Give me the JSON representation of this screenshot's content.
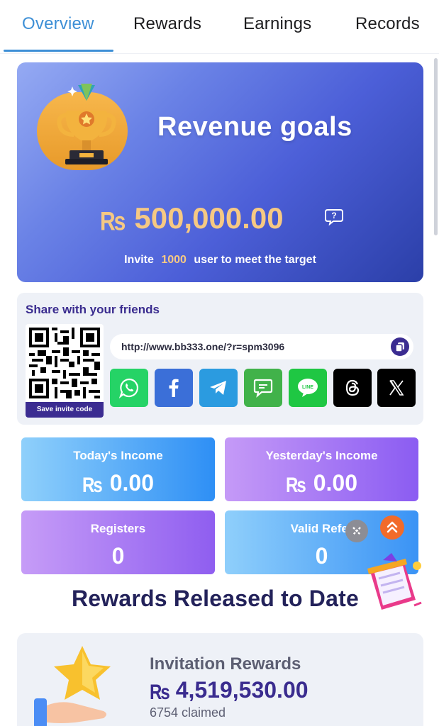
{
  "tabs": [
    {
      "label": "Overview",
      "active": true
    },
    {
      "label": "Rewards",
      "active": false
    },
    {
      "label": "Earnings",
      "active": false
    },
    {
      "label": "Records",
      "active": false
    }
  ],
  "revenue": {
    "title": "Revenue goals",
    "currency": "Rs",
    "amount": "500,000.00",
    "help_icon": "question-bubble-icon",
    "note_prefix": "Invite",
    "note_count": "1000",
    "note_suffix": "user to meet the target"
  },
  "share": {
    "title": "Share with your friends",
    "save_label": "Save invite code",
    "link": "http://www.bb333.one/?r=spm3096",
    "copy_icon": "copy-icon",
    "socials": [
      {
        "name": "whatsapp",
        "color": "#25d366"
      },
      {
        "name": "facebook",
        "color": "#3b6fd8"
      },
      {
        "name": "telegram",
        "color": "#2b9be0"
      },
      {
        "name": "sms",
        "color": "#41b24a"
      },
      {
        "name": "line",
        "color": "#1fc743"
      },
      {
        "name": "threads",
        "color": "#000000"
      },
      {
        "name": "x",
        "color": "#000000"
      }
    ]
  },
  "stats": {
    "today": {
      "label": "Today's Income",
      "currency": "Rs",
      "value": "0.00"
    },
    "yesterday": {
      "label": "Yesterday's Income",
      "currency": "Rs",
      "value": "0.00"
    },
    "registers": {
      "label": "Registers",
      "value": "0"
    },
    "valid": {
      "label": "Valid Refer",
      "value": "0"
    }
  },
  "released": {
    "title": "Rewards Released to Date"
  },
  "invitation": {
    "label": "Invitation Rewards",
    "currency": "Rs",
    "amount": "4,519,530.00",
    "claimed": "6754 claimed"
  },
  "colors": {
    "accent": "#3d8fd6",
    "brand_dark": "#3b2c91",
    "gold": "#f6c983"
  }
}
